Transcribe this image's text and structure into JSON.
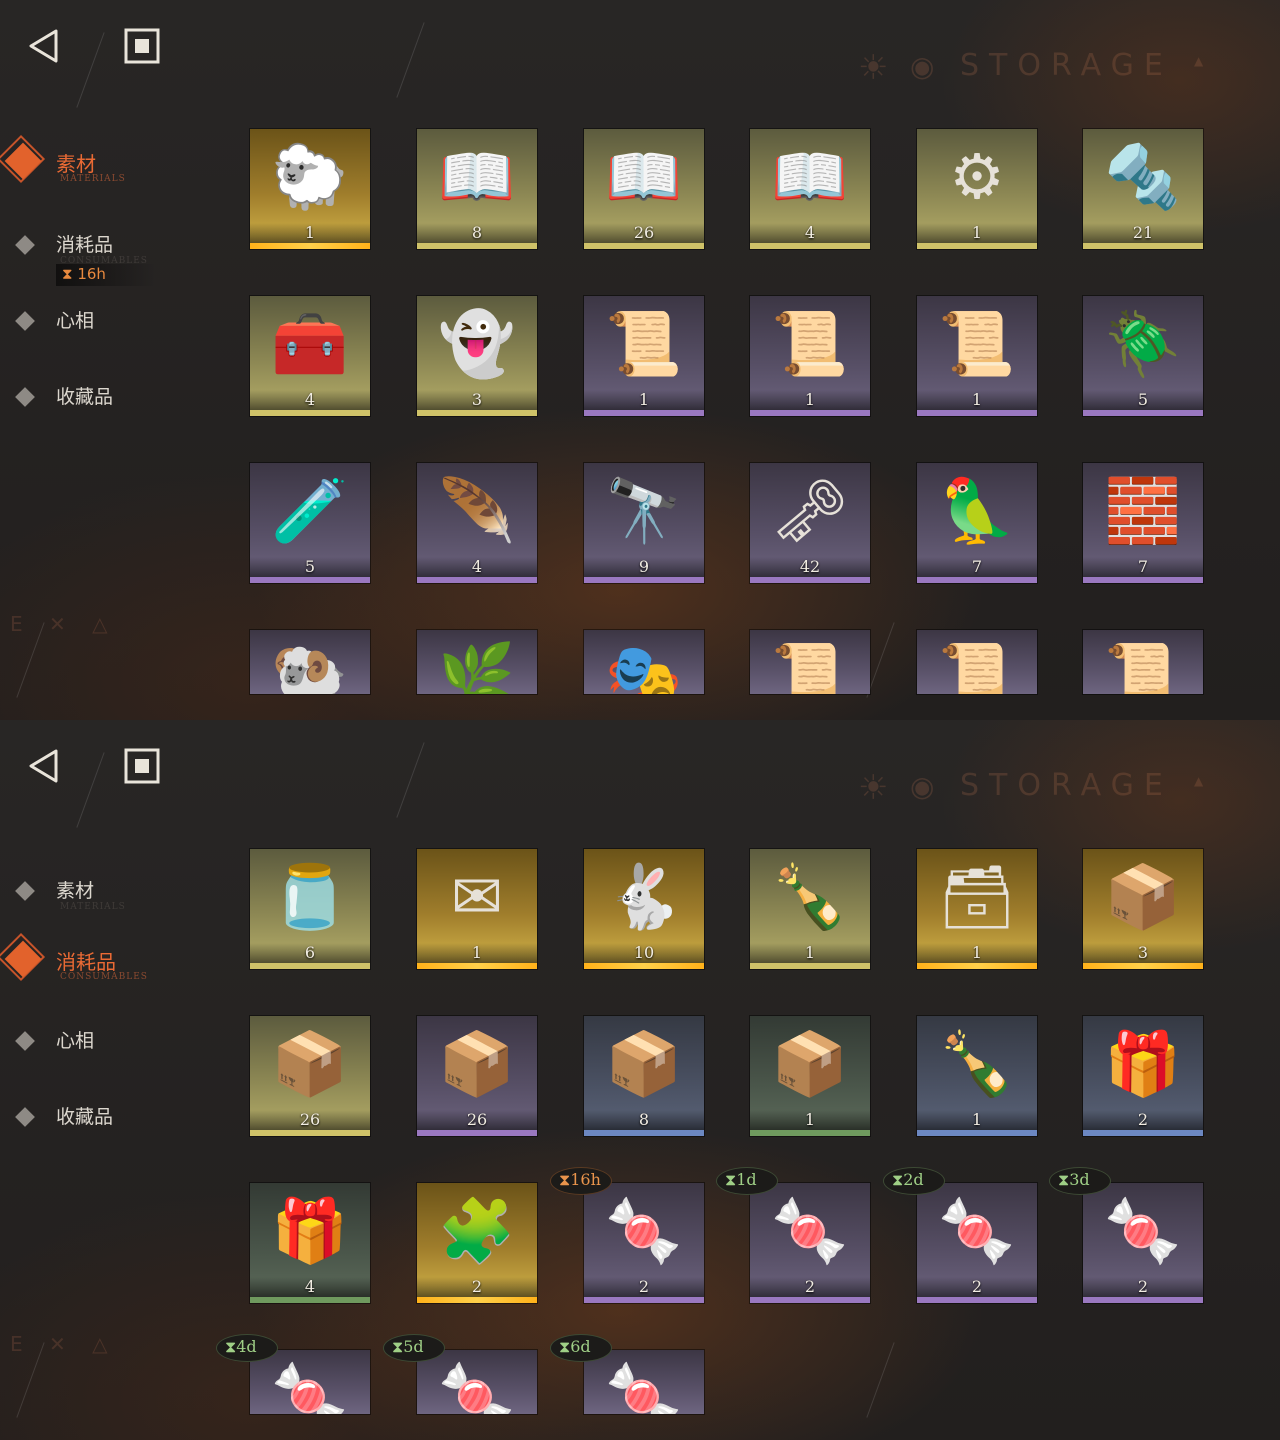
{
  "panels": [
    {
      "watermark": {
        "title": "STORAGE"
      },
      "corner_mark": "E ✕ △",
      "nav": [
        {
          "label": "素材",
          "sub": "MATERIALS",
          "active": true
        },
        {
          "label": "消耗品",
          "sub": "CONSUMABLES",
          "active": false,
          "timer": "16h"
        },
        {
          "label": "心相",
          "sub": "",
          "active": false
        },
        {
          "label": "收藏品",
          "sub": "",
          "active": false
        }
      ],
      "grid": [
        [
          {
            "icon": "gold-sheep-icon",
            "glyph": "🐑",
            "count": "1",
            "rarity": "gold"
          },
          {
            "icon": "green-tome-icon",
            "glyph": "📖",
            "count": "8",
            "rarity": "goldl"
          },
          {
            "icon": "blue-tome-icon",
            "glyph": "📖",
            "count": "26",
            "rarity": "goldl"
          },
          {
            "icon": "gold-tome-icon",
            "glyph": "📖",
            "count": "4",
            "rarity": "goldl"
          },
          {
            "icon": "clockwork-gear-icon",
            "glyph": "⚙",
            "count": "1",
            "rarity": "goldl"
          },
          {
            "icon": "silver-bullets-icon",
            "glyph": "🔩",
            "count": "21",
            "rarity": "goldl"
          }
        ],
        [
          {
            "icon": "hand-in-box-icon",
            "glyph": "🧰",
            "count": "4",
            "rarity": "goldl"
          },
          {
            "icon": "ghost-icon",
            "glyph": "👻",
            "count": "3",
            "rarity": "goldl"
          },
          {
            "icon": "red-scroll-bundle-icon",
            "glyph": "📜",
            "count": "1",
            "rarity": "purple"
          },
          {
            "icon": "blue-scroll-bundle-icon",
            "glyph": "📜",
            "count": "1",
            "rarity": "purple"
          },
          {
            "icon": "gold-scroll-bundle-icon",
            "glyph": "📜",
            "count": "1",
            "rarity": "purple"
          },
          {
            "icon": "scarab-pendant-icon",
            "glyph": "🪲",
            "count": "5",
            "rarity": "purple"
          }
        ],
        [
          {
            "icon": "crystal-vial-icon",
            "glyph": "🧪",
            "count": "5",
            "rarity": "purple"
          },
          {
            "icon": "feather-case-icon",
            "glyph": "🪶",
            "count": "4",
            "rarity": "purple"
          },
          {
            "icon": "brass-orb-icon",
            "glyph": "🔭",
            "count": "9",
            "rarity": "purple"
          },
          {
            "icon": "dragonfly-key-icon",
            "glyph": "🗝",
            "count": "42",
            "rarity": "purple"
          },
          {
            "icon": "glass-bird-icon",
            "glyph": "🦜",
            "count": "7",
            "rarity": "purple"
          },
          {
            "icon": "silver-ingot-icon",
            "glyph": "🧱",
            "count": "7",
            "rarity": "purple"
          }
        ],
        [
          {
            "icon": "skeleton-ram-icon",
            "glyph": "🐏",
            "count": "",
            "rarity": "purple"
          },
          {
            "icon": "cotton-plant-icon",
            "glyph": "🌿",
            "count": "",
            "rarity": "purple"
          },
          {
            "icon": "mask-icon",
            "glyph": "🎭",
            "count": "",
            "rarity": "purple"
          },
          {
            "icon": "scroll-icon",
            "glyph": "📜",
            "count": "",
            "rarity": "purple"
          },
          {
            "icon": "scroll-icon",
            "glyph": "📜",
            "count": "",
            "rarity": "purple"
          },
          {
            "icon": "scroll-icon",
            "glyph": "📜",
            "count": "",
            "rarity": "purple"
          }
        ]
      ]
    },
    {
      "watermark": {
        "title": "STORAGE"
      },
      "corner_mark": "E ✕ △",
      "nav": [
        {
          "label": "素材",
          "sub": "MATERIALS",
          "active": false
        },
        {
          "label": "消耗品",
          "sub": "CONSUMABLES",
          "active": true
        },
        {
          "label": "心相",
          "sub": "",
          "active": false
        },
        {
          "label": "收藏品",
          "sub": "",
          "active": false
        }
      ],
      "grid": [
        [
          {
            "icon": "candy-jar-icon",
            "glyph": "🫙",
            "count": "6",
            "rarity": "goldl"
          },
          {
            "icon": "envelope-icon",
            "glyph": "✉",
            "count": "1",
            "rarity": "gold"
          },
          {
            "icon": "rabbit-box-icon",
            "glyph": "🐇",
            "count": "10",
            "rarity": "gold"
          },
          {
            "icon": "bottle-icon",
            "glyph": "🍾",
            "count": "1",
            "rarity": "goldl"
          },
          {
            "icon": "rune-chest-icon",
            "glyph": "🗃",
            "count": "1",
            "rarity": "gold"
          },
          {
            "icon": "gold-crate-icon",
            "glyph": "📦",
            "count": "3",
            "rarity": "gold"
          }
        ],
        [
          {
            "icon": "crate-icon",
            "glyph": "📦",
            "count": "26",
            "rarity": "goldl"
          },
          {
            "icon": "crate-icon",
            "glyph": "📦",
            "count": "26",
            "rarity": "purple"
          },
          {
            "icon": "crate-icon",
            "glyph": "📦",
            "count": "8",
            "rarity": "blue"
          },
          {
            "icon": "crate-icon",
            "glyph": "📦",
            "count": "1",
            "rarity": "green"
          },
          {
            "icon": "bottle-icon",
            "glyph": "🍾",
            "count": "1",
            "rarity": "blue"
          },
          {
            "icon": "parcel-icon",
            "glyph": "🎁",
            "count": "2",
            "rarity": "blue"
          }
        ],
        [
          {
            "icon": "parcel-icon",
            "glyph": "🎁",
            "count": "4",
            "rarity": "green"
          },
          {
            "icon": "puzzle-box-icon",
            "glyph": "🧩",
            "count": "2",
            "rarity": "gold"
          },
          {
            "icon": "candy-icon",
            "glyph": "🍬",
            "count": "2",
            "rarity": "purple",
            "expiry": "16h",
            "expiry_style": "orange"
          },
          {
            "icon": "candy-icon",
            "glyph": "🍬",
            "count": "2",
            "rarity": "purple",
            "expiry": "1d",
            "expiry_style": "green"
          },
          {
            "icon": "candy-icon",
            "glyph": "🍬",
            "count": "2",
            "rarity": "purple",
            "expiry": "2d",
            "expiry_style": "green"
          },
          {
            "icon": "candy-icon",
            "glyph": "🍬",
            "count": "2",
            "rarity": "purple",
            "expiry": "3d",
            "expiry_style": "green"
          }
        ],
        [
          {
            "icon": "candy-icon",
            "glyph": "🍬",
            "count": "",
            "rarity": "purple",
            "expiry": "4d",
            "expiry_style": "green"
          },
          {
            "icon": "candy-icon",
            "glyph": "🍬",
            "count": "",
            "rarity": "purple",
            "expiry": "5d",
            "expiry_style": "green"
          },
          {
            "icon": "candy-icon",
            "glyph": "🍬",
            "count": "",
            "rarity": "purple",
            "expiry": "6d",
            "expiry_style": "green"
          }
        ]
      ]
    }
  ]
}
